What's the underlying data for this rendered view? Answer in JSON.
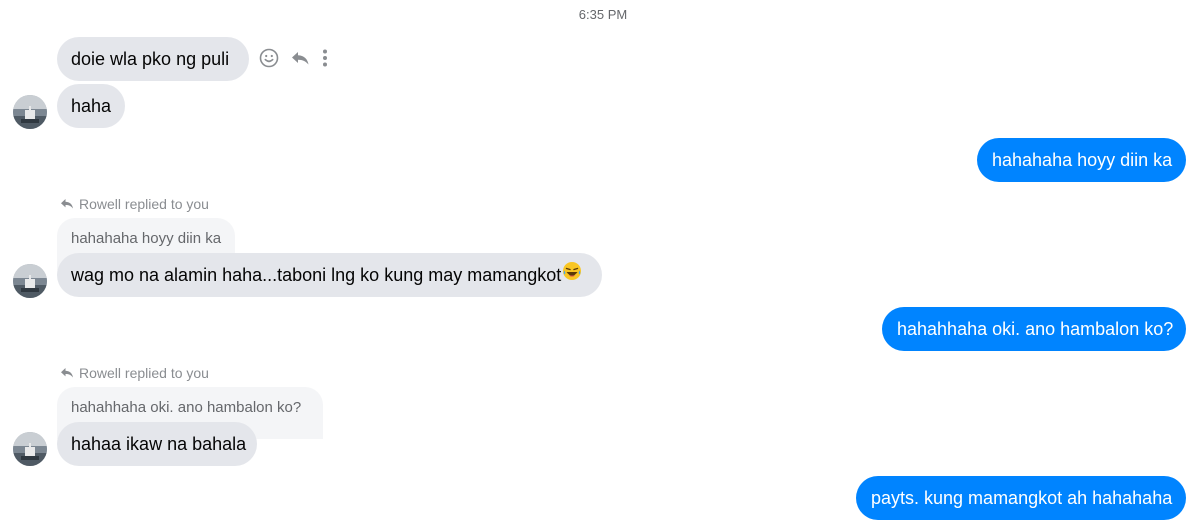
{
  "timestamp": "6:35 PM",
  "contact": {
    "name": "Rowell"
  },
  "messages": {
    "m1": "doie wla pko ng puli",
    "m2": "haha",
    "m3": "hahahaha hoyy diin ka",
    "m4_reply_note": "Rowell replied to you",
    "m4_quoted": "hahahaha hoyy diin ka",
    "m4": "wag mo na alamin haha...taboni lng ko kung may mamangkot",
    "m5": "hahahhaha oki. ano hambalon ko?",
    "m6_reply_note": "Rowell replied to you",
    "m6_quoted": "hahahhaha oki. ano hambalon ko?",
    "m6": "hahaa ikaw na bahala",
    "m7": "payts. kung mamangkot ah hahahaha"
  },
  "icons": {
    "reaction": "smiley-icon",
    "reply": "reply-arrow-icon",
    "more": "more-vertical-icon",
    "emoji": "laughing-tears-emoji"
  },
  "colors": {
    "incoming_bubble": "#e4e6eb",
    "outgoing_bubble": "#0084ff",
    "quoted_bubble": "#f4f5f7",
    "meta_text": "#65676b"
  }
}
